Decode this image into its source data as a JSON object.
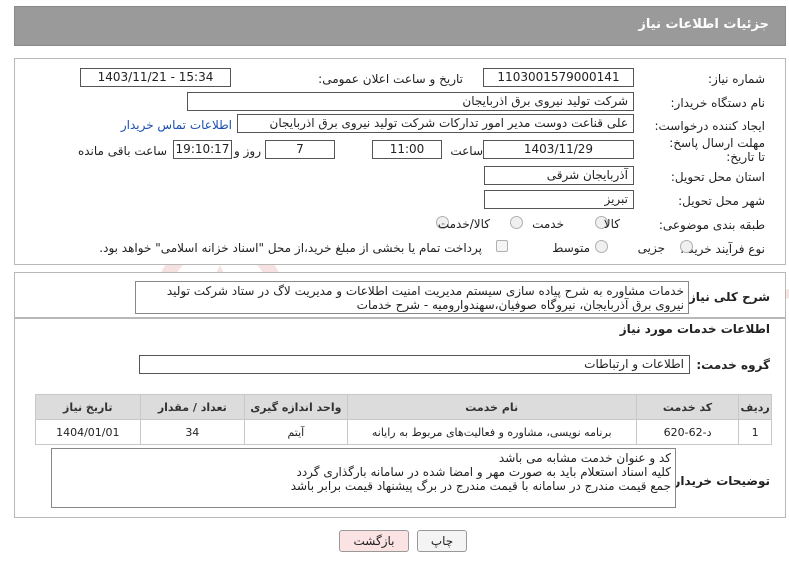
{
  "header": {
    "title": "جزئیات اطلاعات نیاز"
  },
  "fields": {
    "need_number_label": "شماره نیاز:",
    "need_number": "1103001579000141",
    "announce_label": "تاریخ و ساعت اعلان عمومی:",
    "announce_value": "1403/11/21 - 15:34",
    "buyer_org_label": "نام دستگاه خریدار:",
    "buyer_org": "شرکت تولید نیروی برق اذربایجان",
    "creator_label": "ایجاد کننده درخواست:",
    "creator": "علی قناعت دوست مدیر امور تدارکات شرکت تولید نیروی برق اذربایجان",
    "contact_link": "اطلاعات تماس خریدار",
    "deadline_label": "مهلت ارسال پاسخ: تا تاریخ:",
    "deadline_date": "1403/11/29",
    "time_label": "ساعت",
    "deadline_time": "11:00",
    "days_value": "7",
    "days_label": "روز و",
    "remaining_time": "19:10:17",
    "remaining_label": "ساعت باقی مانده",
    "province_label": "استان محل تحویل:",
    "province": "آذربایجان شرقی",
    "city_label": "شهر محل تحویل:",
    "city": "تبریز",
    "category_label": "طبقه بندی موضوعی:",
    "category_options": [
      "کالا",
      "خدمت",
      "کالا/خدمت"
    ],
    "process_label": "نوع فرآیند خرید :",
    "process_options": [
      "جزیی",
      "متوسط"
    ],
    "treasury_text": "پرداخت تمام یا بخشی از مبلغ خرید،از محل \"اسناد خزانه اسلامی\" خواهد بود."
  },
  "summary": {
    "label": "شرح کلی نیاز:",
    "text": "خدمات مشاوره به شرح پیاده سازی سیستم مدیریت امنیت اطلاعات و مدیریت لاگ در ستاد شرکت تولید نیروی برق آذربایجان، نیروگاه صوفیان،سهندوارومیه - شرح خدمات"
  },
  "services": {
    "section_title": "اطلاعات خدمات مورد نیاز",
    "group_label": "گروه خدمت:",
    "group_value": "اطلاعات و ارتباطات",
    "columns": [
      "ردیف",
      "کد خدمت",
      "نام خدمت",
      "واحد اندازه گیری",
      "تعداد / مقدار",
      "تاریخ نیاز"
    ],
    "rows": [
      [
        "1",
        "د-62-620",
        "برنامه نویسی، مشاوره و فعالیت‌های مربوط به رایانه",
        "آیتم",
        "34",
        "1404/01/01"
      ]
    ]
  },
  "notes": {
    "label": "توضیحات خریدار:",
    "lines": [
      "کد و عنوان خدمت مشابه می باشد",
      "کلیه اسناد استعلام باید به صورت مهر و امضا شده در سامانه بارگذاری گردد",
      "جمع قیمت مندرج در سامانه با قیمت مندرج در برگ پیشنهاد قیمت برابر باشد"
    ]
  },
  "buttons": {
    "print": "چاپ",
    "back": "بازگشت"
  },
  "watermark": {
    "text": "AriaTender.neT"
  },
  "colors": {
    "header_bg": "#9a9a9a",
    "link": "#1a4fb0",
    "back_btn_bg": "#fbe3e3"
  }
}
